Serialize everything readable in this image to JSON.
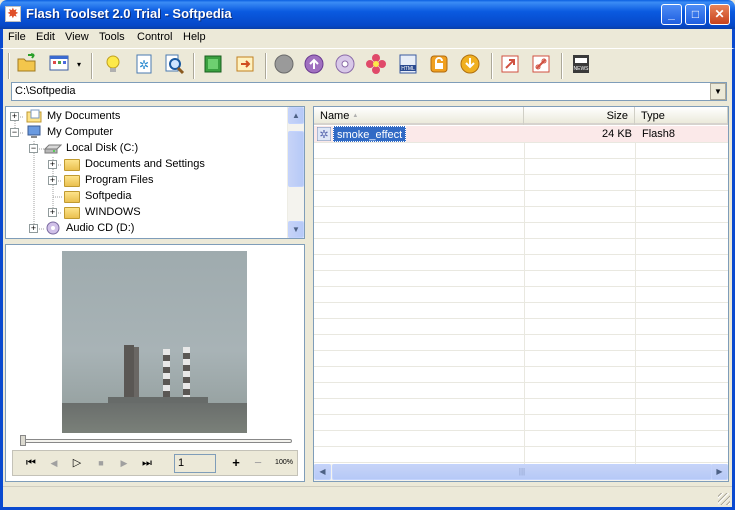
{
  "window": {
    "title": "Flash Toolset 2.0 Trial - Softpedia"
  },
  "titlebar_buttons": {
    "minimize": "_",
    "maximize": "□",
    "close": "✕"
  },
  "menu": [
    "File",
    "Edit",
    "View",
    "Tools",
    "Control",
    "Help"
  ],
  "toolbar": {
    "icons": [
      "open-folder-icon",
      "view-mode-icon",
      "lightbulb-icon",
      "snowflake-doc-icon",
      "magnifier-icon",
      "green-square-icon",
      "export-icon",
      "gray-circle-icon",
      "upload-icon",
      "cd-icon",
      "flower-icon",
      "html-icon",
      "lock-icon",
      "download-icon",
      "arrow-out-icon",
      "link-icon",
      "news-icon"
    ],
    "html_label": "HTML",
    "news_label": "NEWS"
  },
  "address": {
    "path": "C:\\Softpedia"
  },
  "tree": {
    "items": [
      {
        "label": "My Documents",
        "level": 0,
        "expander": "+"
      },
      {
        "label": "My Computer",
        "level": 0,
        "expander": "−"
      },
      {
        "label": "Local Disk (C:)",
        "level": 1,
        "expander": "−"
      },
      {
        "label": "Documents and Settings",
        "level": 2,
        "expander": "+"
      },
      {
        "label": "Program Files",
        "level": 2,
        "expander": "+"
      },
      {
        "label": "Softpedia",
        "level": 2,
        "expander": ""
      },
      {
        "label": "WINDOWS",
        "level": 2,
        "expander": "+"
      },
      {
        "label": "Audio CD (D:)",
        "level": 1,
        "expander": "+"
      }
    ]
  },
  "player": {
    "frame_value": "1",
    "zoom_label": "100%",
    "buttons": {
      "first": "⏮",
      "prev": "◀",
      "play": "▷",
      "stop": "■",
      "next": "▶",
      "last": "⏭",
      "zoom_in": "+",
      "zoom_out": "−"
    }
  },
  "file_list": {
    "columns": [
      "Name",
      "Size",
      "Type"
    ],
    "sort_indicator": "▲",
    "rows": [
      {
        "name": "smoke_effect",
        "size": "24 KB",
        "type": "Flash8"
      }
    ]
  },
  "colors": {
    "titlebar": "#0a5ae0",
    "selection": "#316ac5",
    "row_highlight": "#fbe9e9"
  }
}
